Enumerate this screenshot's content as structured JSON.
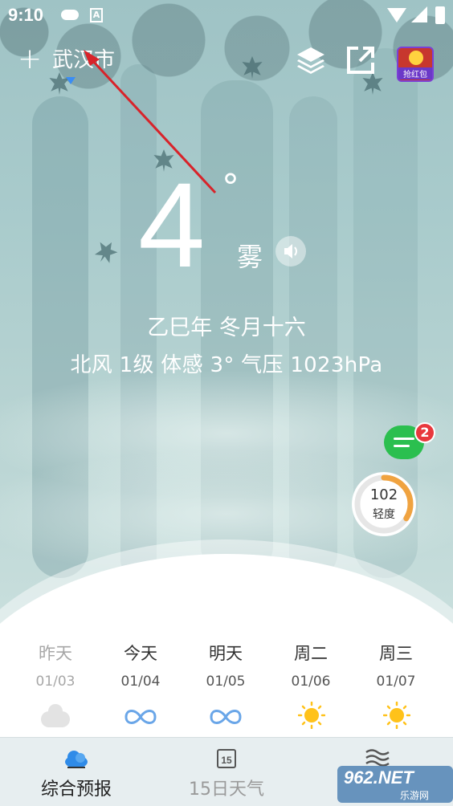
{
  "status_bar": {
    "time": "9:10",
    "a_label": "A"
  },
  "header": {
    "add_label": "+",
    "city": "武汉市",
    "redpack_label": "抢红包"
  },
  "current": {
    "temperature": "4",
    "degree_symbol": "°",
    "condition": "雾",
    "lunar_date": "乙巳年 冬月十六",
    "details": "北风 1级  体感 3°  气压 1023hPa"
  },
  "message_badge": "2",
  "aqi": {
    "value": "102",
    "level": "轻度",
    "progress": 0.34,
    "color": "#f0a340"
  },
  "forecast": [
    {
      "name": "昨天",
      "date": "01/03",
      "icon": "cloud-icon",
      "past": true
    },
    {
      "name": "今天",
      "date": "01/04",
      "icon": "fog-icon",
      "past": false
    },
    {
      "name": "明天",
      "date": "01/05",
      "icon": "fog-icon",
      "past": false
    },
    {
      "name": "周二",
      "date": "01/06",
      "icon": "sun-icon",
      "past": false
    },
    {
      "name": "周三",
      "date": "01/07",
      "icon": "sun-icon",
      "past": false
    }
  ],
  "tabs": {
    "overview": {
      "label": "综合预报",
      "icon": "cloud-icon"
    },
    "fifteen_day": {
      "label": "15日天气",
      "icon_text": "15"
    },
    "more": {
      "icon": "wind-icon"
    }
  },
  "watermark": {
    "brand": "962.NET",
    "subtitle": "乐游网"
  },
  "colors": {
    "accent": "#3a8df5",
    "badge": "#e8383d",
    "chat": "#2bbf4f",
    "sun": "#ffc21a",
    "fog": "#6aa6e8"
  }
}
